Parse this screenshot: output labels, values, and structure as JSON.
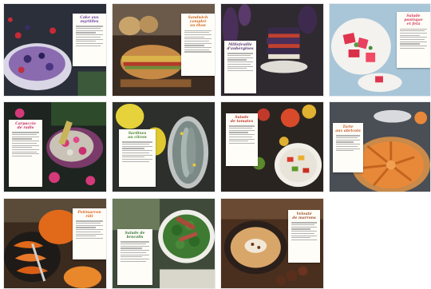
{
  "gallery": {
    "tiles": [
      {
        "id": "berry-cake",
        "accent": "#6b3fa0",
        "title_lines": [
          "Cake aux",
          "myrtilles"
        ],
        "bg": "#2b2f3a"
      },
      {
        "id": "bread-sandwich",
        "accent": "#d2691e",
        "title_lines": [
          "Sandwich complet",
          "au thon"
        ],
        "bg": "#3a2c22"
      },
      {
        "id": "eggplant-stack",
        "accent": "#5a3d78",
        "title_lines": [
          "Millefeuille",
          "d'aubergines"
        ],
        "bg": "#2f2a30"
      },
      {
        "id": "watermelon-salad",
        "accent": "#d63a5a",
        "title_lines": [
          "Salade pastèque",
          "et feta"
        ],
        "bg": "#a9c6d8"
      },
      {
        "id": "radish-platter",
        "accent": "#c72b6a",
        "title_lines": [
          "Carpaccio",
          "de radis"
        ],
        "bg": "#1e2420"
      },
      {
        "id": "fish-lemon",
        "accent": "#4a8b3a",
        "title_lines": [
          "Sardines",
          "au citron"
        ],
        "bg": "#2c2f2b"
      },
      {
        "id": "tomato-salad",
        "accent": "#c0392b",
        "title_lines": [
          "Salade",
          "de tomates"
        ],
        "bg": "#2a2420"
      },
      {
        "id": "apricot-tart",
        "accent": "#c8612a",
        "title_lines": [
          "Tarte",
          "aux abricots"
        ],
        "bg": "#4a4e55"
      },
      {
        "id": "pumpkin-roast",
        "accent": "#d9661f",
        "title_lines": [
          "Potimarron",
          "rôti"
        ],
        "bg": "#3b2a1e"
      },
      {
        "id": "broccoli-bowl",
        "accent": "#3c7a3c",
        "title_lines": [
          "Salade de",
          "brocolis"
        ],
        "bg": "#3f4a3a"
      },
      {
        "id": "soup-bowl",
        "accent": "#a0522d",
        "title_lines": [
          "Velouté",
          "de marrons"
        ],
        "bg": "#4a2f1f"
      }
    ]
  }
}
